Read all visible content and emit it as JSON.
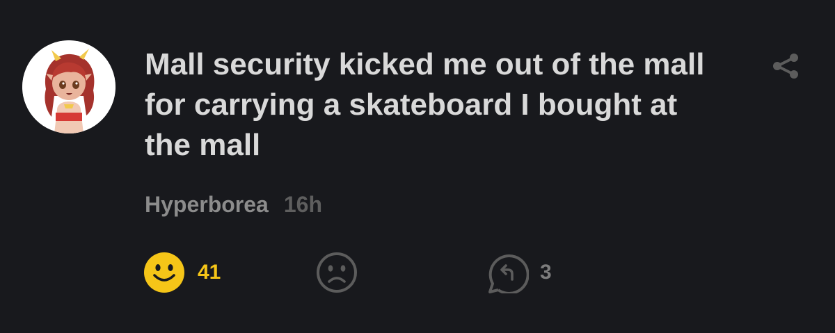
{
  "post": {
    "text": "Mall security kicked me out of the mall for carrying a skateboard I bought at the mall",
    "author": "Hyperborea",
    "time": "16h"
  },
  "actions": {
    "like": {
      "icon": "smile-icon",
      "count": "41",
      "color": "#f5c518"
    },
    "dislike": {
      "icon": "frown-icon"
    },
    "reply": {
      "icon": "reply-icon",
      "count": "3"
    }
  },
  "icons": {
    "share": "share-icon",
    "avatar": "avatar-image"
  },
  "colors": {
    "background": "#18191d",
    "text": "#d9d9d9",
    "accent": "#f5c518",
    "muted": "#5e5e5e"
  }
}
